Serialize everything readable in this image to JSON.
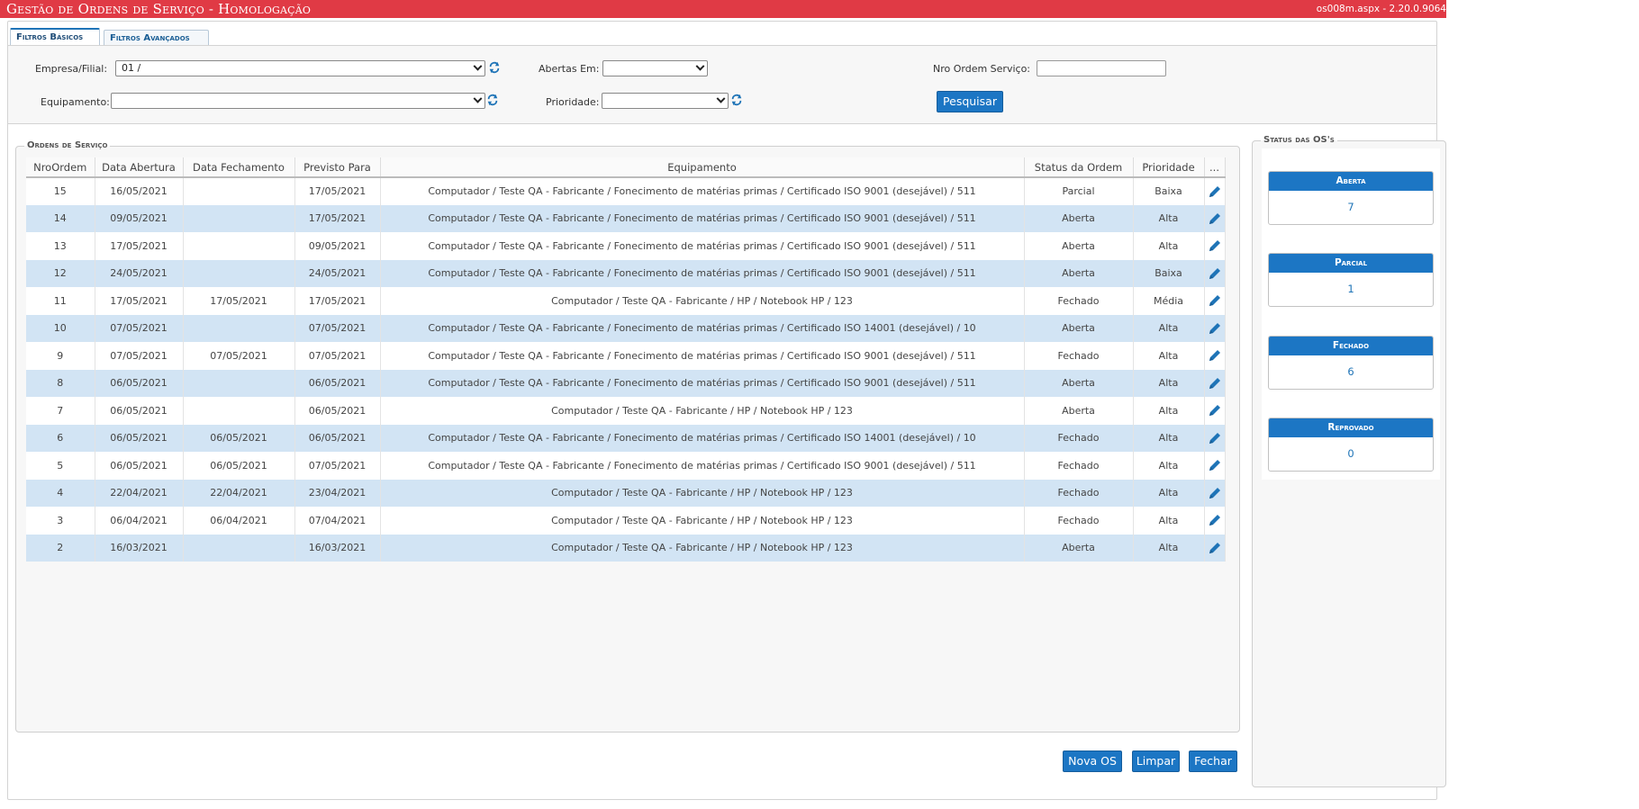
{
  "app": {
    "title": "Gestão de Ordens de Serviço  - Homologação",
    "version": "os008m.aspx - 2.20.0.9064"
  },
  "tabs": [
    {
      "label": "Filtros Básicos",
      "active": true
    },
    {
      "label": "Filtros Avançados",
      "active": false
    }
  ],
  "filters": {
    "empresa_label": "Empresa/Filial:",
    "empresa_value": "01 /",
    "abertas_label": "Abertas Em:",
    "abertas_value": "",
    "nro_label": "Nro Ordem Serviço:",
    "nro_value": "",
    "equipamento_label": "Equipamento:",
    "equipamento_value": "",
    "prioridade_label": "Prioridade:",
    "prioridade_value": "",
    "search_label": "Pesquisar"
  },
  "orders": {
    "legend": "Ordens de Serviço",
    "columns": [
      "NroOrdem",
      "Data Abertura",
      "Data Fechamento",
      "Previsto Para",
      "Equipamento",
      "Status da Ordem",
      "Prioridade",
      "..."
    ],
    "rows": [
      [
        "15",
        "16/05/2021",
        "",
        "17/05/2021",
        "Computador / Teste QA - Fabricante / Fonecimento de matérias primas / Certificado ISO 9001 (desejável) / 511",
        "Parcial",
        "Baixa"
      ],
      [
        "14",
        "09/05/2021",
        "",
        "17/05/2021",
        "Computador / Teste QA - Fabricante / Fonecimento de matérias primas / Certificado ISO 9001 (desejável) / 511",
        "Aberta",
        "Alta"
      ],
      [
        "13",
        "17/05/2021",
        "",
        "09/05/2021",
        "Computador / Teste QA - Fabricante / Fonecimento de matérias primas / Certificado ISO 9001 (desejável) / 511",
        "Aberta",
        "Alta"
      ],
      [
        "12",
        "24/05/2021",
        "",
        "24/05/2021",
        "Computador / Teste QA - Fabricante / Fonecimento de matérias primas / Certificado ISO 9001 (desejável) / 511",
        "Aberta",
        "Baixa"
      ],
      [
        "11",
        "17/05/2021",
        "17/05/2021",
        "17/05/2021",
        "Computador / Teste QA - Fabricante / HP / Notebook HP / 123",
        "Fechado",
        "Média"
      ],
      [
        "10",
        "07/05/2021",
        "",
        "07/05/2021",
        "Computador / Teste QA - Fabricante / Fonecimento de matérias primas / Certificado ISO 14001 (desejável) / 10",
        "Aberta",
        "Alta"
      ],
      [
        "9",
        "07/05/2021",
        "07/05/2021",
        "07/05/2021",
        "Computador / Teste QA - Fabricante / Fonecimento de matérias primas / Certificado ISO 9001 (desejável) / 511",
        "Fechado",
        "Alta"
      ],
      [
        "8",
        "06/05/2021",
        "",
        "06/05/2021",
        "Computador / Teste QA - Fabricante / Fonecimento de matérias primas / Certificado ISO 9001 (desejável) / 511",
        "Aberta",
        "Alta"
      ],
      [
        "7",
        "06/05/2021",
        "",
        "06/05/2021",
        "Computador / Teste QA - Fabricante / HP / Notebook HP / 123",
        "Aberta",
        "Alta"
      ],
      [
        "6",
        "06/05/2021",
        "06/05/2021",
        "06/05/2021",
        "Computador / Teste QA - Fabricante / Fonecimento de matérias primas / Certificado ISO 14001 (desejável) / 10",
        "Fechado",
        "Alta"
      ],
      [
        "5",
        "06/05/2021",
        "06/05/2021",
        "07/05/2021",
        "Computador / Teste QA - Fabricante / Fonecimento de matérias primas / Certificado ISO 9001 (desejável) / 511",
        "Fechado",
        "Alta"
      ],
      [
        "4",
        "22/04/2021",
        "22/04/2021",
        "23/04/2021",
        "Computador / Teste QA - Fabricante / HP / Notebook HP / 123",
        "Fechado",
        "Alta"
      ],
      [
        "3",
        "06/04/2021",
        "06/04/2021",
        "07/04/2021",
        "Computador / Teste QA - Fabricante / HP / Notebook HP / 123",
        "Fechado",
        "Alta"
      ],
      [
        "2",
        "16/03/2021",
        "",
        "16/03/2021",
        "Computador / Teste QA - Fabricante / HP / Notebook HP / 123",
        "Aberta",
        "Alta"
      ]
    ]
  },
  "status": {
    "legend": "Status das OS's",
    "cards": [
      {
        "label": "Aberta",
        "count": "7"
      },
      {
        "label": "Parcial",
        "count": "1"
      },
      {
        "label": "Fechado",
        "count": "6"
      },
      {
        "label": "Reprovado",
        "count": "0"
      }
    ]
  },
  "actions": {
    "new_label": "Nova OS",
    "clear_label": "Limpar",
    "close_label": "Fechar"
  },
  "colors": {
    "header_bar": "#e03a45",
    "primary_button": "#1c76c4",
    "row_stripe": "#d2e4f4"
  }
}
